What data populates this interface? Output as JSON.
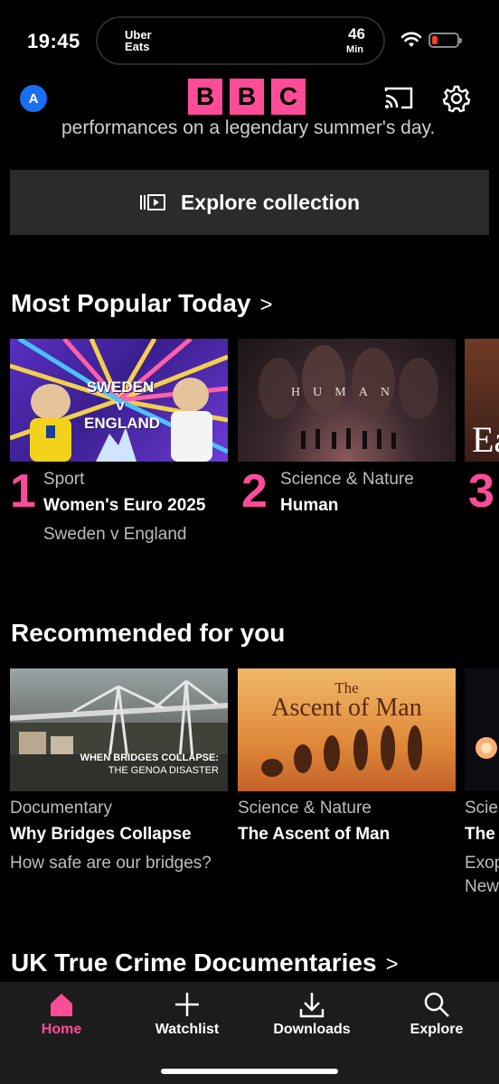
{
  "status_bar": {
    "time": "19:45",
    "live_activity": {
      "app": "Uber\nEats",
      "minutes": "46",
      "unit": "Min"
    },
    "battery_color": "#ff3b30"
  },
  "header": {
    "avatar_letter": "A",
    "logo_letters": [
      "B",
      "B",
      "C"
    ],
    "brand_color": "#ff4c98",
    "icons": [
      "cast-icon",
      "gear-icon"
    ]
  },
  "promo": {
    "text": "performances on a legendary summer's day.",
    "explore_label": "Explore collection"
  },
  "most_popular": {
    "title": "Most Popular Today",
    "items": [
      {
        "rank": "1",
        "category": "Sport",
        "title": "Women's Euro 2025",
        "subtitle": "Sweden v England",
        "thumb_text": "SWEDEN v ENGLAND"
      },
      {
        "rank": "2",
        "category": "Science & Nature",
        "title": "Human",
        "subtitle": "",
        "thumb_text": "HUMAN"
      },
      {
        "rank": "3",
        "category": "",
        "title": "",
        "subtitle": "",
        "thumb_text": "Ea"
      }
    ]
  },
  "recommended": {
    "title": "Recommended for you",
    "items": [
      {
        "category": "Documentary",
        "title": "Why Bridges Collapse",
        "subtitle": "How safe are our bridges?",
        "thumb_line1": "WHEN BRIDGES COLLAPSE:",
        "thumb_line2": "THE GENOA DISASTER"
      },
      {
        "category": "Science & Nature",
        "title": "The Ascent of Man",
        "subtitle": "",
        "thumb_line1": "The",
        "thumb_line2": "Ascent of Man"
      },
      {
        "category": "Scie",
        "title": "The",
        "subtitle": "Exop",
        "subtitle2": "New"
      }
    ]
  },
  "next_section": {
    "title": "UK True Crime Documentaries"
  },
  "tab_bar": {
    "tabs": [
      {
        "label": "Home",
        "icon": "home-icon",
        "active": true
      },
      {
        "label": "Watchlist",
        "icon": "plus-icon",
        "active": false
      },
      {
        "label": "Downloads",
        "icon": "download-icon",
        "active": false
      },
      {
        "label": "Explore",
        "icon": "search-icon",
        "active": false
      }
    ]
  }
}
